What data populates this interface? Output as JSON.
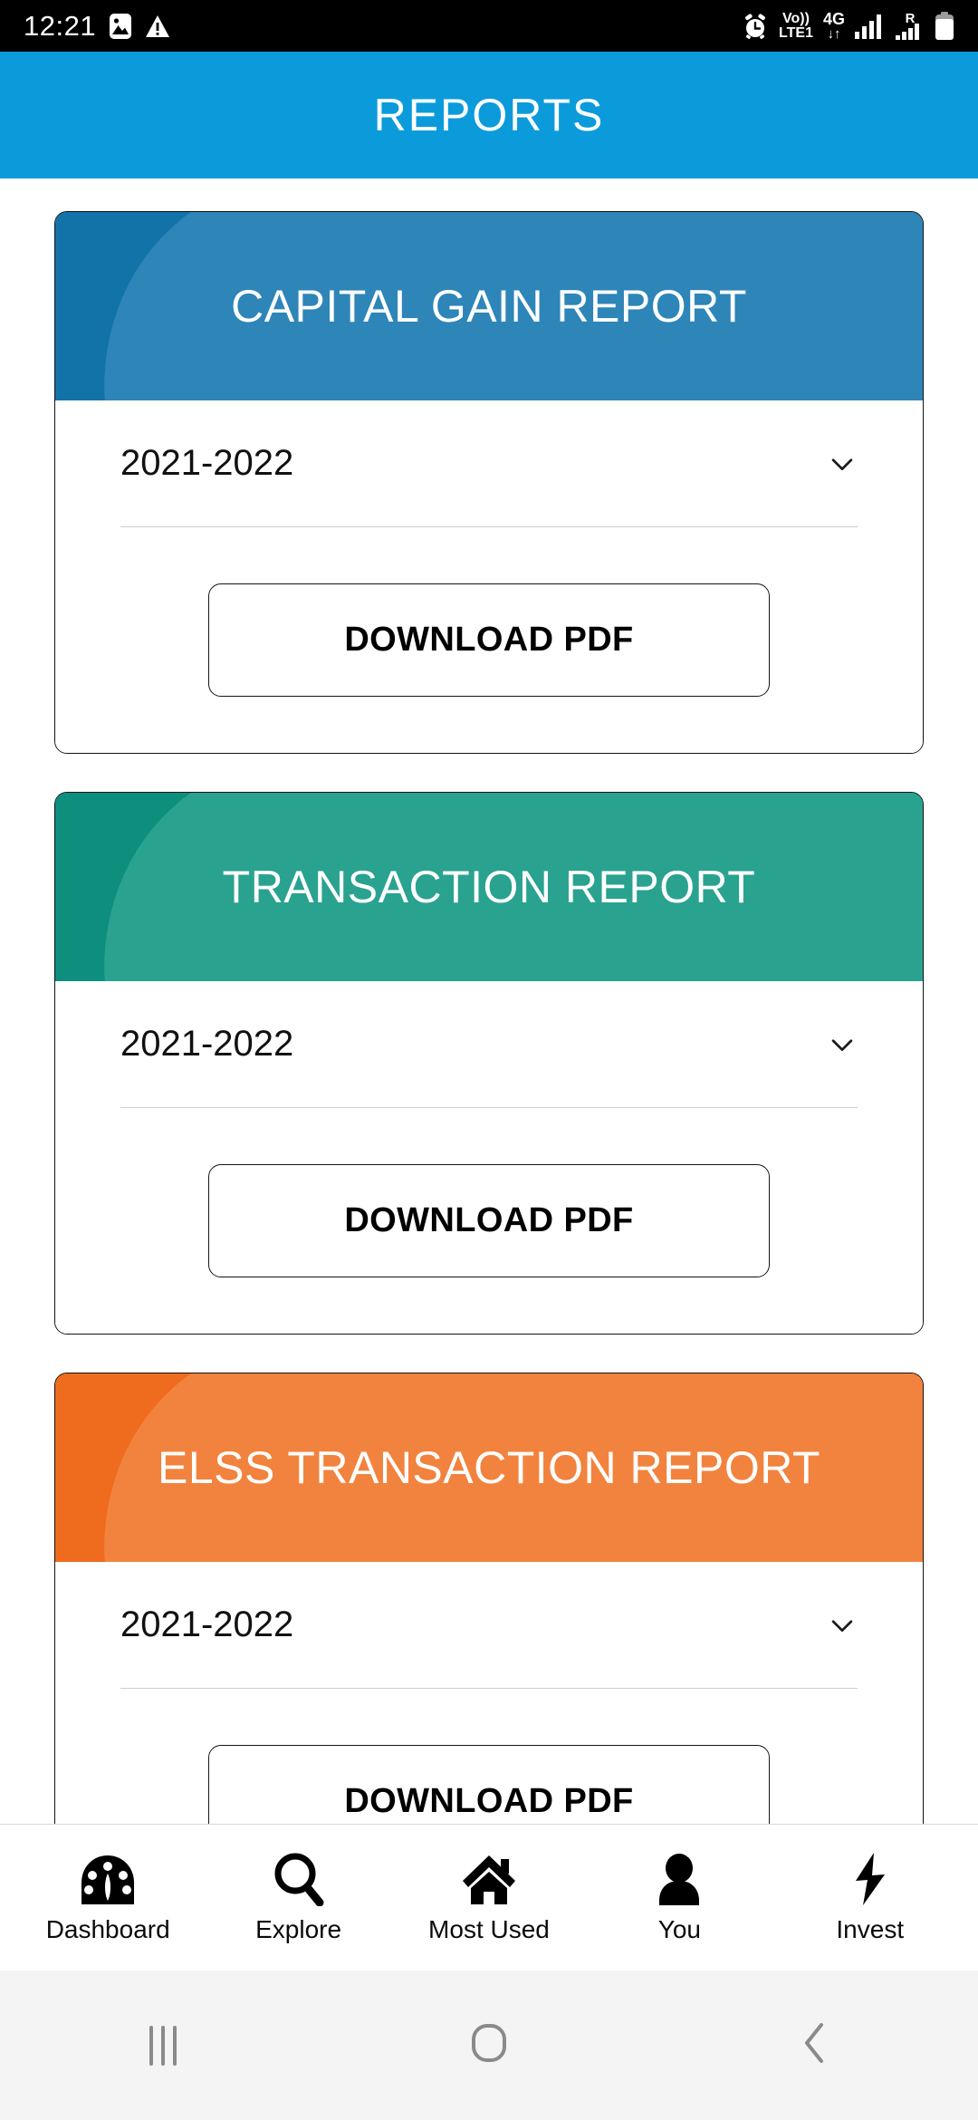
{
  "status_bar": {
    "time": "12:21",
    "left_icons": [
      "image-icon",
      "warning-triangle-icon"
    ],
    "alarm_icon": "alarm-icon",
    "volte_line1": "Vo))",
    "volte_line2": "LTE1",
    "network_type": "4G",
    "data_arrows": "↓↑",
    "roaming_tag": "R",
    "battery_icon": "battery-icon"
  },
  "app_bar": {
    "title": "REPORTS"
  },
  "cards": [
    {
      "id": "capital-gain-report",
      "title": "CAPITAL GAIN REPORT",
      "base_color": "#1273a9",
      "arc_color": "#2e85b8",
      "year_value": "2021-2022",
      "chevron_icon": "chevron-down-icon",
      "download_label": "DOWNLOAD PDF"
    },
    {
      "id": "transaction-report",
      "title": "TRANSACTION REPORT",
      "base_color": "#0e8e7d",
      "arc_color": "#2aa290",
      "year_value": "2021-2022",
      "chevron_icon": "chevron-down-icon",
      "download_label": "DOWNLOAD PDF"
    },
    {
      "id": "elss-transaction-report",
      "title": "ELSS TRANSACTION REPORT",
      "base_color": "#ef6b1d",
      "arc_color": "#f2833e",
      "year_value": "2021-2022",
      "chevron_icon": "chevron-down-icon",
      "download_label": "DOWNLOAD PDF"
    }
  ],
  "bottom_nav": {
    "items": [
      {
        "label": "Dashboard",
        "icon": "dashboard-gauge-icon"
      },
      {
        "label": "Explore",
        "icon": "search-icon"
      },
      {
        "label": "Most Used",
        "icon": "home-icon"
      },
      {
        "label": "You",
        "icon": "person-icon"
      },
      {
        "label": "Invest",
        "icon": "lightning-bolt-icon"
      }
    ]
  },
  "system_nav": {
    "recents_icon": "recents-icon",
    "home_icon": "home-square-icon",
    "back_icon": "back-chevron-icon"
  },
  "colors": {
    "app_bar_blue": "#0b9bdb",
    "status_bar_black": "#000000",
    "system_nav_gray": "#f4f4f4"
  }
}
